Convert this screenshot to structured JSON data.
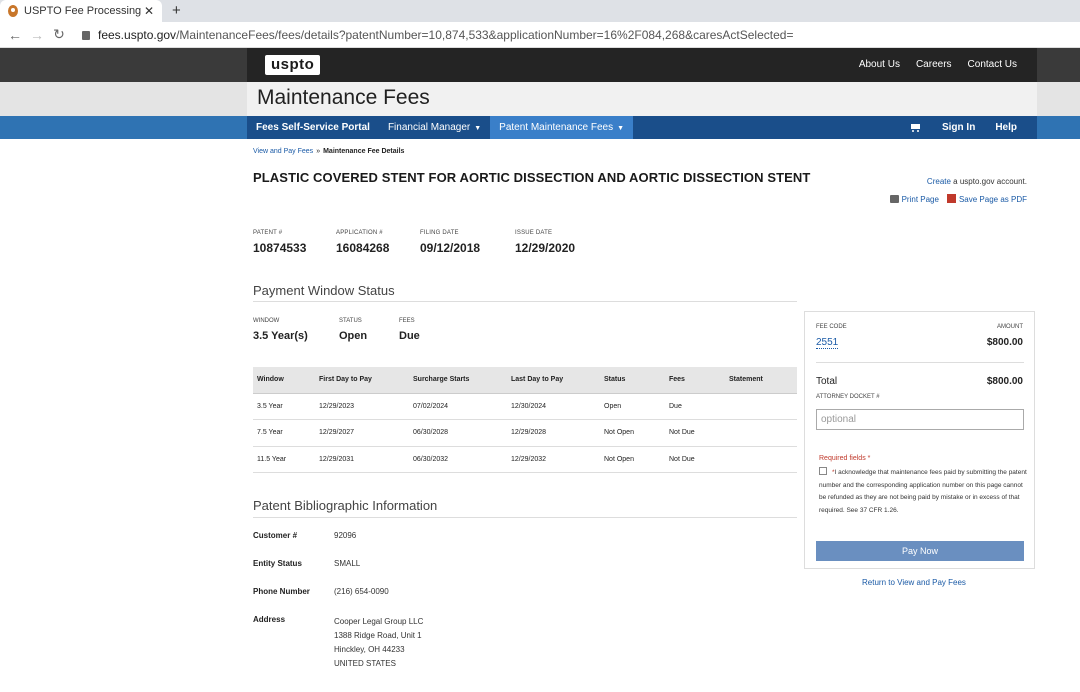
{
  "browser": {
    "tab_title": "USPTO Fee Processing - Maint",
    "tab_close": "✕",
    "new_tab": "+",
    "back": "←",
    "forward": "→",
    "reload": "↻",
    "url_host": "fees.uspto.gov",
    "url_path": "/MaintenanceFees/fees/details?patentNumber=10,874,533&applicationNumber=16%2F084,268&caresActSelected="
  },
  "site": {
    "logo": "uspto",
    "top_links": [
      "About Us",
      "Careers",
      "Contact Us"
    ],
    "title": "Maintenance Fees"
  },
  "nav": {
    "portal": "Fees Self-Service Portal",
    "financial_manager": "Financial Manager",
    "patent_maintenance": "Patent Maintenance Fees",
    "caret": "▼",
    "sign_in": "Sign In",
    "help": "Help"
  },
  "breadcrumb": {
    "parent": "View and Pay Fees",
    "sep": "»",
    "current": "Maintenance Fee Details"
  },
  "page_title": "PLASTIC COVERED STENT FOR AORTIC DISSECTION AND AORTIC DISSECTION STENT",
  "account": {
    "create": "Create",
    "rest": " a uspto.gov account.",
    "print": "Print Page",
    "save_pdf": "Save Page as PDF"
  },
  "meta": {
    "patent_label": "PATENT #",
    "patent": "10874533",
    "application_label": "APPLICATION #",
    "application": "16084268",
    "filing_label": "FILING DATE",
    "filing": "09/12/2018",
    "issue_label": "ISSUE DATE",
    "issue": "12/29/2020"
  },
  "payment_window": {
    "title": "Payment Window Status",
    "window_label": "WINDOW",
    "window": "3.5 Year(s)",
    "status_label": "STATUS",
    "status": "Open",
    "fees_label": "FEES",
    "fees": "Due"
  },
  "fee_table": {
    "headers": [
      "Window",
      "First Day to Pay",
      "Surcharge Starts",
      "Last Day to Pay",
      "Status",
      "Fees",
      "Statement"
    ],
    "rows": [
      [
        "3.5 Year",
        "12/29/2023",
        "07/02/2024",
        "12/30/2024",
        "Open",
        "Due",
        ""
      ],
      [
        "7.5 Year",
        "12/29/2027",
        "06/30/2028",
        "12/29/2028",
        "Not Open",
        "Not Due",
        ""
      ],
      [
        "11.5 Year",
        "12/29/2031",
        "06/30/2032",
        "12/29/2032",
        "Not Open",
        "Not Due",
        ""
      ]
    ]
  },
  "bibliographic": {
    "title": "Patent Bibliographic Information",
    "customer_label": "Customer #",
    "customer": "92096",
    "entity_label": "Entity Status",
    "entity": "SMALL",
    "phone_label": "Phone Number",
    "phone": "(216) 654-0090",
    "address_label": "Address",
    "address": [
      "Cooper Legal Group LLC",
      "1388 Ridge Road, Unit 1",
      "Hinckley, OH 44233",
      "UNITED STATES"
    ]
  },
  "panel": {
    "fee_code_label": "FEE CODE",
    "amount_label": "AMOUNT",
    "fee_code": "2551",
    "amount": "$800.00",
    "total_label": "Total",
    "total": "$800.00",
    "docket_label": "ATTORNEY DOCKET #",
    "docket_placeholder": "optional",
    "required": "Required fields *",
    "ack_star": "*",
    "ack_text": "I acknowledge that maintenance fees paid by submitting the patent number and the corresponding application number on this page cannot be refunded as they are not being paid by mistake or in excess of that required. See 37 CFR 1.26.",
    "pay_now": "Pay Now"
  },
  "return_link": "Return to View and Pay Fees"
}
